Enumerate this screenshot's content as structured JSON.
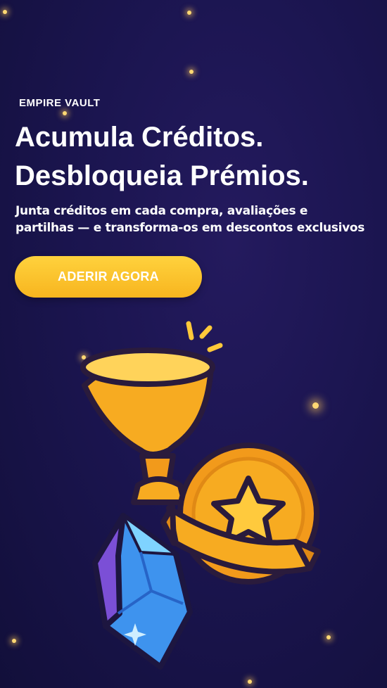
{
  "hero": {
    "eyebrow": "EMPIRE VAULT",
    "headline_line1": "Acumula Créditos.",
    "headline_line2": "Desbloqueia Prémios.",
    "subtitle_line1": "Junta créditos em cada compra, avaliações e",
    "subtitle_line2": "partilhas — e transforma-os em descontos exclusivos",
    "cta_label": "ADERIR AGORA"
  },
  "colors": {
    "background": "#1b1550",
    "accent": "#f7b51f",
    "gold": "#f6a623",
    "gem": "#4aa8f5"
  },
  "illustration": {
    "icons": [
      "trophy-icon",
      "star-medal-icon",
      "gem-icon"
    ]
  }
}
